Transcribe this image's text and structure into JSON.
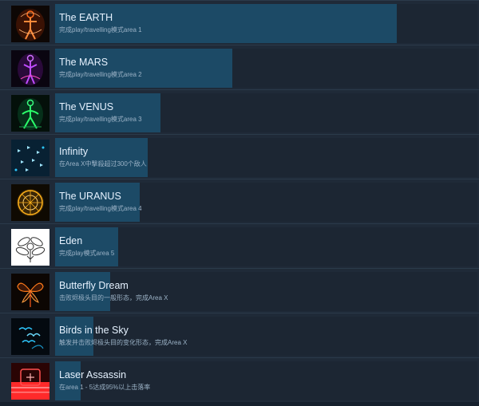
{
  "achievements": [
    {
      "title": "The EARTH",
      "desc": "完成play/travelling模式area 1",
      "progress": 0.81,
      "icon": "earth-figure-icon",
      "accent": "#ff6a1a"
    },
    {
      "title": "The MARS",
      "desc": "完成play/travelling模式area 2",
      "progress": 0.42,
      "icon": "mars-figure-icon",
      "accent": "#c04cff"
    },
    {
      "title": "The VENUS",
      "desc": "完成play/travelling模式area 3",
      "progress": 0.25,
      "icon": "venus-figure-icon",
      "accent": "#2bff6a"
    },
    {
      "title": "Infinity",
      "desc": "在Area X中撃殺超过300个敌人",
      "progress": 0.22,
      "icon": "infinity-swarm-icon",
      "accent": "#2ec8ff"
    },
    {
      "title": "The URANUS",
      "desc": "完成play/travelling模式area 4",
      "progress": 0.2,
      "icon": "uranus-emblem-icon",
      "accent": "#ffb21a"
    },
    {
      "title": "Eden",
      "desc": "完成play模式area 5",
      "progress": 0.15,
      "icon": "eden-flower-icon",
      "accent": "#ffffff"
    },
    {
      "title": "Butterfly Dream",
      "desc": "击败烬极头目的一般形态，完成Area X",
      "progress": 0.13,
      "icon": "butterfly-icon",
      "accent": "#ff7a1a"
    },
    {
      "title": "Birds in the Sky",
      "desc": "触发并击败烬极头目的变化形态，完成Area X",
      "progress": 0.09,
      "icon": "birds-icon",
      "accent": "#2ec8ff"
    },
    {
      "title": "Laser Assassin",
      "desc": "在area 1 - 5达成95%以上击落率",
      "progress": 0.06,
      "icon": "laser-target-icon",
      "accent": "#ff2a2a"
    }
  ],
  "colors": {
    "bar": "#1c4a66",
    "panel": "#1c2633",
    "background": "#16202d"
  }
}
